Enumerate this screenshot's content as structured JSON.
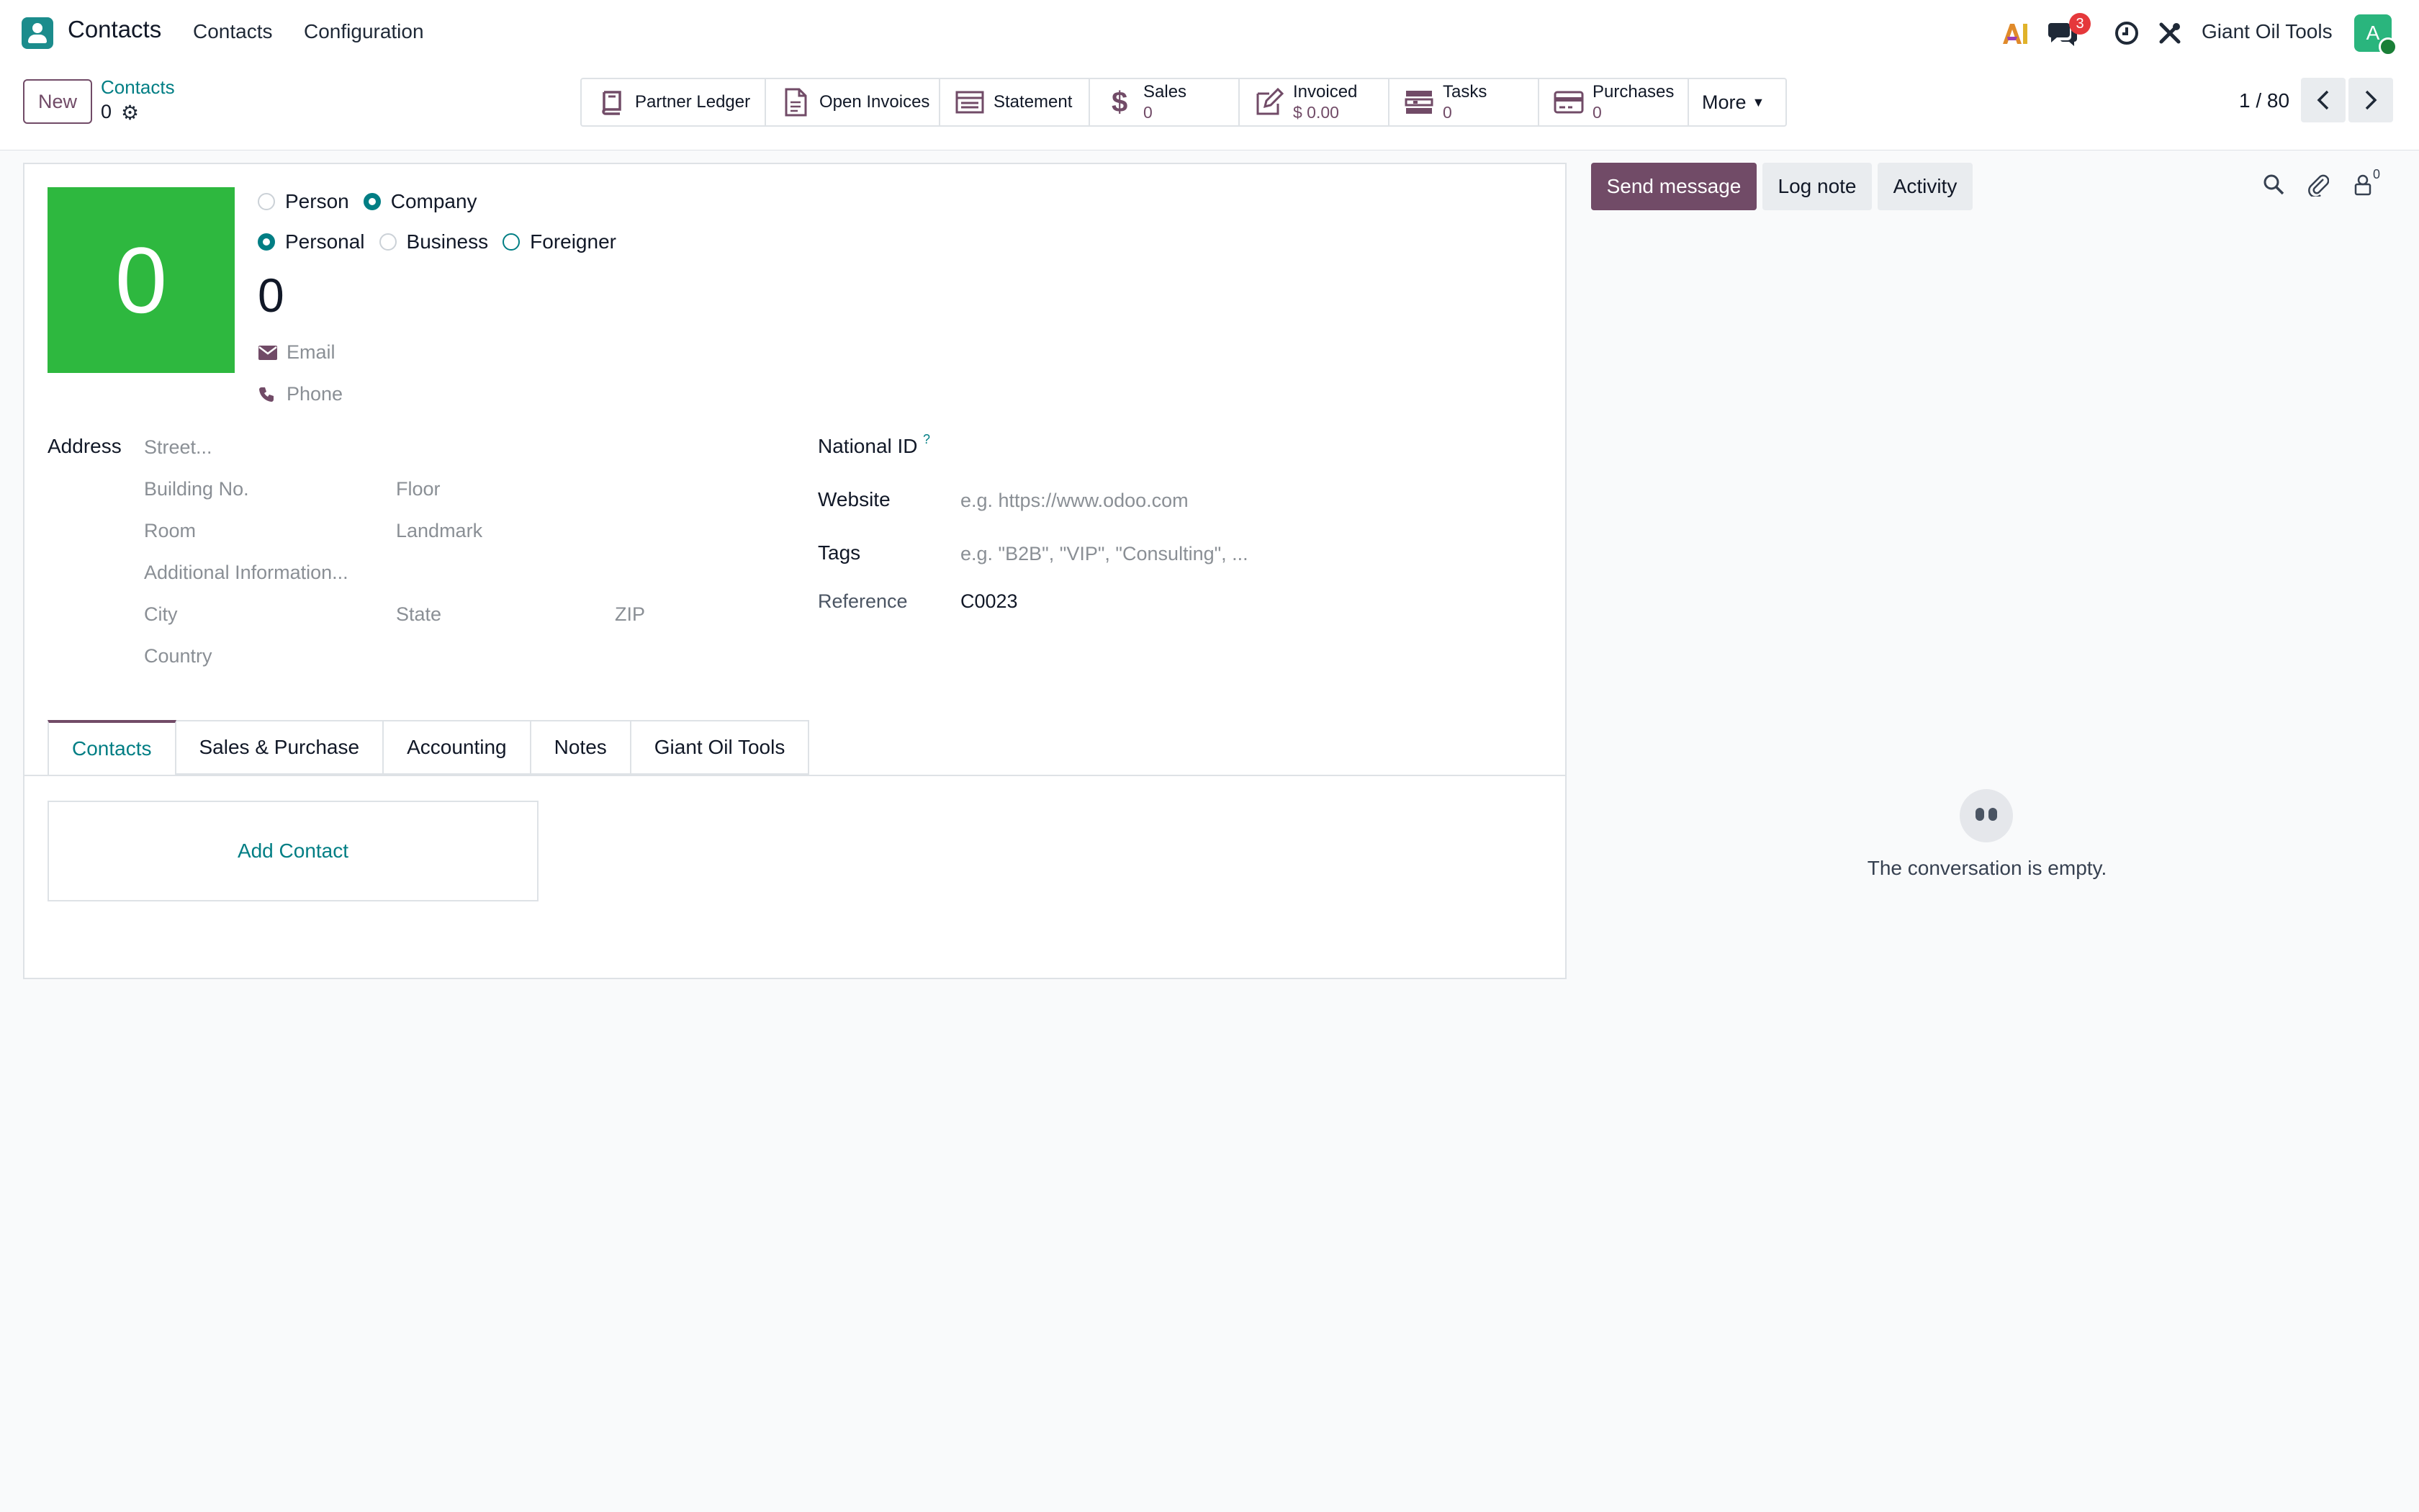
{
  "app": {
    "name": "Contacts",
    "menu": [
      "Contacts",
      "Configuration"
    ]
  },
  "topbar": {
    "messages_badge": "3",
    "company": "Giant Oil Tools",
    "avatar_letter": "A"
  },
  "control": {
    "new_label": "New",
    "breadcrumb": "Contacts",
    "record": "0",
    "smart_buttons": [
      {
        "label": "Partner Ledger",
        "icon": "book-icon"
      },
      {
        "label": "Open Invoices",
        "icon": "document-icon"
      },
      {
        "label": "Statement",
        "icon": "statement-icon"
      },
      {
        "label": "Sales",
        "value": "0",
        "icon": "dollar-icon"
      },
      {
        "label": "Invoiced",
        "value": "$ 0.00",
        "icon": "edit-icon"
      },
      {
        "label": "Tasks",
        "value": "0",
        "icon": "tasks-icon"
      },
      {
        "label": "Purchases",
        "value": "0",
        "icon": "credit-card-icon"
      }
    ],
    "more_label": "More",
    "pager": "1 / 80"
  },
  "form": {
    "avatar_text": "0",
    "type_options": [
      "Person",
      "Company"
    ],
    "category_options": [
      "Personal",
      "Business",
      "Foreigner"
    ],
    "name": "0",
    "email_placeholder": "Email",
    "phone_placeholder": "Phone",
    "address_label": "Address",
    "address": {
      "street": "Street...",
      "building": "Building No.",
      "floor": "Floor",
      "room": "Room",
      "landmark": "Landmark",
      "additional": "Additional Information...",
      "city": "City",
      "state": "State",
      "zip": "ZIP",
      "country": "Country"
    },
    "national_id_label": "National ID",
    "help_mark": "?",
    "website_label": "Website",
    "website_placeholder": "e.g. https://www.odoo.com",
    "tags_label": "Tags",
    "tags_placeholder": "e.g. \"B2B\", \"VIP\", \"Consulting\", ...",
    "reference_label": "Reference",
    "reference_value": "C0023",
    "tabs": [
      "Contacts",
      "Sales & Purchase",
      "Accounting",
      "Notes",
      "Giant Oil Tools"
    ],
    "add_contact": "Add Contact"
  },
  "chatter": {
    "send_message": "Send message",
    "log_note": "Log note",
    "activity": "Activity",
    "followers": "0",
    "empty_text": "The conversation is empty."
  },
  "colors": {
    "primary": "#714b67",
    "accent": "#017e84",
    "avatar_bg": "#2eb83f"
  }
}
